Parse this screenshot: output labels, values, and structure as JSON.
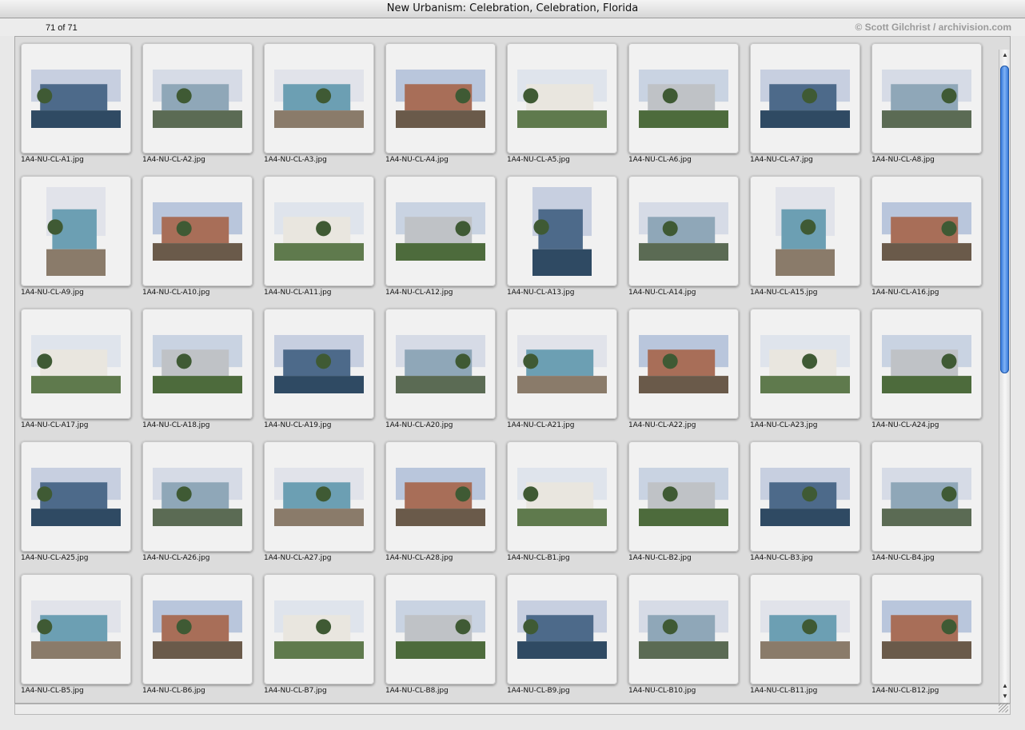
{
  "window": {
    "title": "New Urbanism: Celebration, Celebration, Florida",
    "count": "71 of 71",
    "credit": "© Scott Gilchrist / archivision.com"
  },
  "items": [
    {
      "name": "1A4-NU-CL-A1.jpg",
      "orient": "h"
    },
    {
      "name": "1A4-NU-CL-A2.jpg",
      "orient": "h"
    },
    {
      "name": "1A4-NU-CL-A3.jpg",
      "orient": "h"
    },
    {
      "name": "1A4-NU-CL-A4.jpg",
      "orient": "h"
    },
    {
      "name": "1A4-NU-CL-A5.jpg",
      "orient": "h"
    },
    {
      "name": "1A4-NU-CL-A6.jpg",
      "orient": "h"
    },
    {
      "name": "1A4-NU-CL-A7.jpg",
      "orient": "h"
    },
    {
      "name": "1A4-NU-CL-A8.jpg",
      "orient": "h"
    },
    {
      "name": "1A4-NU-CL-A9.jpg",
      "orient": "v"
    },
    {
      "name": "1A4-NU-CL-A10.jpg",
      "orient": "h"
    },
    {
      "name": "1A4-NU-CL-A11.jpg",
      "orient": "h"
    },
    {
      "name": "1A4-NU-CL-A12.jpg",
      "orient": "h"
    },
    {
      "name": "1A4-NU-CL-A13.jpg",
      "orient": "v"
    },
    {
      "name": "1A4-NU-CL-A14.jpg",
      "orient": "h"
    },
    {
      "name": "1A4-NU-CL-A15.jpg",
      "orient": "v"
    },
    {
      "name": "1A4-NU-CL-A16.jpg",
      "orient": "h"
    },
    {
      "name": "1A4-NU-CL-A17.jpg",
      "orient": "h"
    },
    {
      "name": "1A4-NU-CL-A18.jpg",
      "orient": "h"
    },
    {
      "name": "1A4-NU-CL-A19.jpg",
      "orient": "h"
    },
    {
      "name": "1A4-NU-CL-A20.jpg",
      "orient": "h"
    },
    {
      "name": "1A4-NU-CL-A21.jpg",
      "orient": "h"
    },
    {
      "name": "1A4-NU-CL-A22.jpg",
      "orient": "h"
    },
    {
      "name": "1A4-NU-CL-A23.jpg",
      "orient": "h"
    },
    {
      "name": "1A4-NU-CL-A24.jpg",
      "orient": "h"
    },
    {
      "name": "1A4-NU-CL-A25.jpg",
      "orient": "h"
    },
    {
      "name": "1A4-NU-CL-A26.jpg",
      "orient": "h"
    },
    {
      "name": "1A4-NU-CL-A27.jpg",
      "orient": "h"
    },
    {
      "name": "1A4-NU-CL-A28.jpg",
      "orient": "h"
    },
    {
      "name": "1A4-NU-CL-B1.jpg",
      "orient": "h"
    },
    {
      "name": "1A4-NU-CL-B2.jpg",
      "orient": "h"
    },
    {
      "name": "1A4-NU-CL-B3.jpg",
      "orient": "h"
    },
    {
      "name": "1A4-NU-CL-B4.jpg",
      "orient": "h"
    },
    {
      "name": "1A4-NU-CL-B5.jpg",
      "orient": "h"
    },
    {
      "name": "1A4-NU-CL-B6.jpg",
      "orient": "h"
    },
    {
      "name": "1A4-NU-CL-B7.jpg",
      "orient": "h"
    },
    {
      "name": "1A4-NU-CL-B8.jpg",
      "orient": "h"
    },
    {
      "name": "1A4-NU-CL-B9.jpg",
      "orient": "h"
    },
    {
      "name": "1A4-NU-CL-B10.jpg",
      "orient": "h"
    },
    {
      "name": "1A4-NU-CL-B11.jpg",
      "orient": "h"
    },
    {
      "name": "1A4-NU-CL-B12.jpg",
      "orient": "h"
    }
  ],
  "scrollbar": {
    "up_icon": "scroll-up-arrow-icon",
    "down_icon": "scroll-down-arrow-icon"
  },
  "colors": {
    "scroll_thumb": "#3b7fe0",
    "slide": "#f1f1f1"
  }
}
